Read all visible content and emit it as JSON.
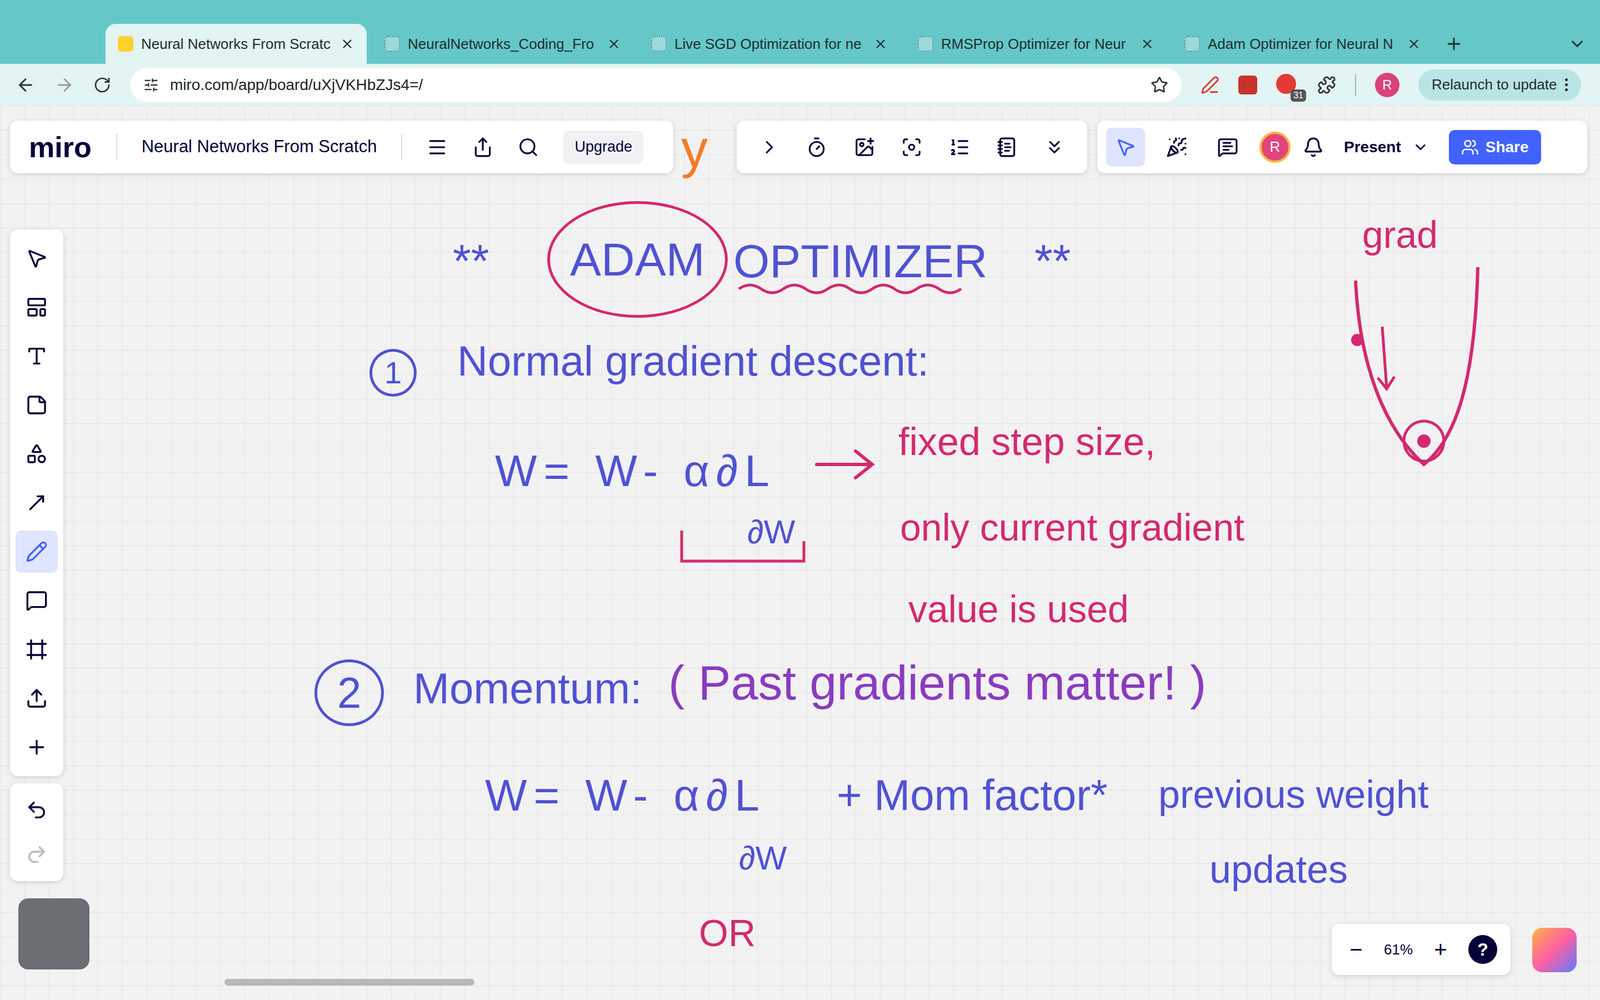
{
  "browser": {
    "tabs": [
      {
        "label": "Neural Networks From Scratc",
        "selected": true
      },
      {
        "label": "NeuralNetworks_Coding_Fro",
        "selected": false
      },
      {
        "label": "Live SGD Optimization for ne",
        "selected": false
      },
      {
        "label": "RMSProp Optimizer for Neur",
        "selected": false
      },
      {
        "label": "Adam Optimizer for Neural N",
        "selected": false
      }
    ],
    "url": "miro.com/app/board/uXjVKHbZJs4=/",
    "extension_badge": "31",
    "profile": "R",
    "relaunch": "Relaunch to update"
  },
  "miro": {
    "logo": "miro",
    "board_title": "Neural Networks From Scratch",
    "upgrade": "Upgrade",
    "toolbar_tools": [
      {
        "selected": true
      },
      {
        "selected": false
      },
      {
        "selected": false
      }
    ],
    "avatar": "R",
    "present": "Present",
    "share": "Share",
    "left_tools": [
      {
        "selected": false
      },
      {
        "selected": false
      },
      {
        "selected": false
      },
      {
        "selected": false
      },
      {
        "selected": false
      },
      {
        "selected": false
      },
      {
        "selected": true
      },
      {
        "selected": false
      },
      {
        "selected": false
      },
      {
        "selected": false
      },
      {
        "selected": false
      }
    ],
    "zoom_out": "−",
    "zoom": "61%",
    "zoom_in": "+",
    "help": "?"
  },
  "canvas": {
    "notes": [
      {
        "text": "y",
        "color": "#f27d2a",
        "circle": ""
      },
      {
        "text": "**",
        "color": "#4f52d3",
        "circle": ""
      },
      {
        "text": "ADAM",
        "color": "#4f52d3",
        "circle": "#d3296f"
      },
      {
        "text": "OPTIMIZER",
        "color": "#4f52d3",
        "circle": ""
      },
      {
        "text": "**",
        "color": "#4f52d3",
        "circle": ""
      },
      {
        "text": "grad",
        "color": "#d3296f",
        "circle": ""
      },
      {
        "text": "1",
        "color": "#4f52d3",
        "circle": "#4f52d3"
      },
      {
        "text": "Normal gradient descent:",
        "color": "#4f52d3",
        "circle": ""
      },
      {
        "text": "W= W- α∂L",
        "color": "#4f52d3",
        "circle": ""
      },
      {
        "text": "∂W",
        "color": "#4f52d3",
        "circle": ""
      },
      {
        "text": "fixed step size,",
        "color": "#d3296f",
        "circle": ""
      },
      {
        "text": "only current gradient",
        "color": "#d3296f",
        "circle": ""
      },
      {
        "text": "value is used",
        "color": "#d3296f",
        "circle": ""
      },
      {
        "text": "2",
        "color": "#4f52d3",
        "circle": "#4f52d3"
      },
      {
        "text": "Momentum:",
        "color": "#4f52d3",
        "circle": ""
      },
      {
        "text": "( Past gradients matter! )",
        "color": "#8a3bbf",
        "circle": ""
      },
      {
        "text": "W= W- α∂L",
        "color": "#4f52d3",
        "circle": ""
      },
      {
        "text": "∂W",
        "color": "#4f52d3",
        "circle": ""
      },
      {
        "text": "+ Mom factor*",
        "color": "#4f52d3",
        "circle": ""
      },
      {
        "text": "previous weight",
        "color": "#4f52d3",
        "circle": ""
      },
      {
        "text": "updates",
        "color": "#4f52d3",
        "circle": ""
      },
      {
        "text": "OR",
        "color": "#d3296f",
        "circle": ""
      }
    ]
  }
}
